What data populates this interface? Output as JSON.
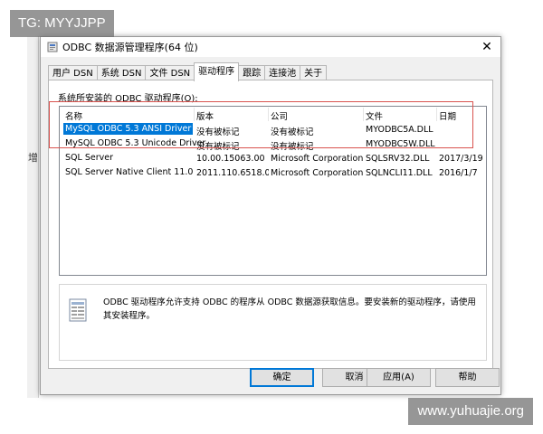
{
  "background_window": {
    "visible_char": "增"
  },
  "dialog": {
    "title": "ODBC 数据源管理程序(64 位)",
    "close_glyph": "✕",
    "tabs": [
      {
        "label": "用户 DSN",
        "active": false
      },
      {
        "label": "系统 DSN",
        "active": false
      },
      {
        "label": "文件 DSN",
        "active": false
      },
      {
        "label": "驱动程序",
        "active": true
      },
      {
        "label": "跟踪",
        "active": false
      },
      {
        "label": "连接池",
        "active": false
      },
      {
        "label": "关于",
        "active": false
      }
    ],
    "list_label": "系统所安装的 ODBC 驱动程序(O):",
    "columns": [
      "名称",
      "版本",
      "公司",
      "文件",
      "日期"
    ],
    "rows": [
      {
        "name": "MySQL ODBC 5.3 ANSI Driver",
        "version": "没有被标记",
        "company": "没有被标记",
        "file": "MYODBC5A.DLL",
        "date": "",
        "selected": true
      },
      {
        "name": "MySQL ODBC 5.3 Unicode Driver",
        "version": "没有被标记",
        "company": "没有被标记",
        "file": "MYODBC5W.DLL",
        "date": "",
        "selected": false
      },
      {
        "name": "SQL Server",
        "version": "10.00.15063.00",
        "company": "Microsoft Corporation",
        "file": "SQLSRV32.DLL",
        "date": "2017/3/19",
        "selected": false
      },
      {
        "name": "SQL Server Native Client 11.0",
        "version": "2011.110.6518.00",
        "company": "Microsoft Corporation",
        "file": "SQLNCLI11.DLL",
        "date": "2016/1/7",
        "selected": false
      }
    ],
    "info_text": "ODBC 驱动程序允许支持 ODBC 的程序从 ODBC 数据源获取信息。要安装新的驱动程序，请使用其安装程序。",
    "buttons": {
      "ok": "确定",
      "cancel": "取消",
      "apply": "应用(A)",
      "help": "帮助"
    }
  },
  "colors": {
    "selection": "#0078d7",
    "highlight_box": "#d9534f",
    "dialog_bg": "#f0f0f0"
  },
  "watermarks": {
    "top_left": "TG: MYYJJPP",
    "bottom_right": "www.yuhuajie.org"
  }
}
